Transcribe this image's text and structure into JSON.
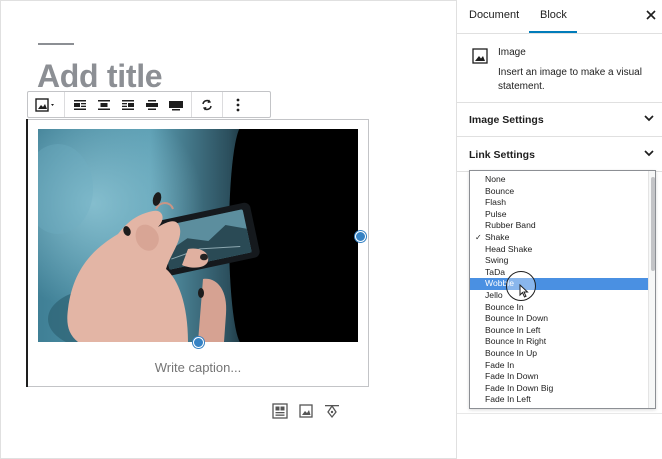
{
  "editor": {
    "title_placeholder": "Add title",
    "caption_placeholder": "Write caption..."
  },
  "toolbar": {
    "icons": [
      "image-icon",
      "align-left-icon",
      "align-center-icon",
      "align-right-icon",
      "align-wide-icon",
      "align-full-icon",
      "replace-icon",
      "more-options-icon"
    ]
  },
  "sidebar": {
    "tabs": [
      {
        "label": "Document",
        "active": false
      },
      {
        "label": "Block",
        "active": true
      }
    ],
    "block_card": {
      "name": "Image",
      "description": "Insert an image to make a visual statement."
    },
    "panels": [
      {
        "title": "Image Settings"
      },
      {
        "title": "Link Settings"
      }
    ]
  },
  "animation_dropdown": {
    "selected": "Shake",
    "highlighted": "Wobble",
    "options": [
      "None",
      "Bounce",
      "Flash",
      "Pulse",
      "Rubber Band",
      "Shake",
      "Head Shake",
      "Swing",
      "TaDa",
      "Wobble",
      "Jello",
      "Bounce In",
      "Bounce In Down",
      "Bounce In Left",
      "Bounce In Right",
      "Bounce In Up",
      "Fade In",
      "Fade In Down",
      "Fade In Down Big",
      "Fade In Left"
    ]
  },
  "colors": {
    "accent": "#007cba",
    "highlight": "#4a90e2",
    "handle": "#3582c4",
    "placeholder": "#8c8f94"
  }
}
